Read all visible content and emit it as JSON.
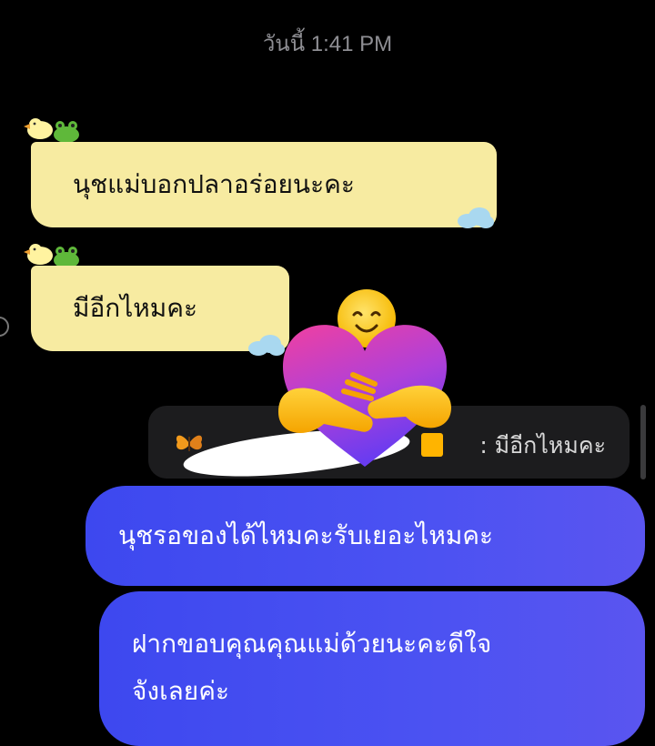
{
  "timestamp": "วันนี้ 1:41 PM",
  "incoming": [
    {
      "text": "นุชแม่บอกปลาอร่อยนะคะ"
    },
    {
      "text": "มีอีกไหมคะ"
    }
  ],
  "reply": {
    "quoted_text": ": มีอีกไหมคะ"
  },
  "outgoing": [
    {
      "text": "นุชรอของได้ไหมคะรับเยอะไหมคะ"
    },
    {
      "line1": "ฝากขอบคุณคุณแม่ด้วยนะคะดีใจ",
      "line2": "จังเลยค่ะ"
    }
  ],
  "colors": {
    "background": "#000000",
    "incoming_bubble": "#f7eba1",
    "outgoing_bubble": "#4b52f2",
    "reply_preview": "#1c1c1e",
    "timestamp": "#8e8e93"
  },
  "icons": [
    "duck-icon",
    "frog-icon",
    "cloud-icon",
    "butterfly-icon",
    "hugging-face-emoji"
  ]
}
